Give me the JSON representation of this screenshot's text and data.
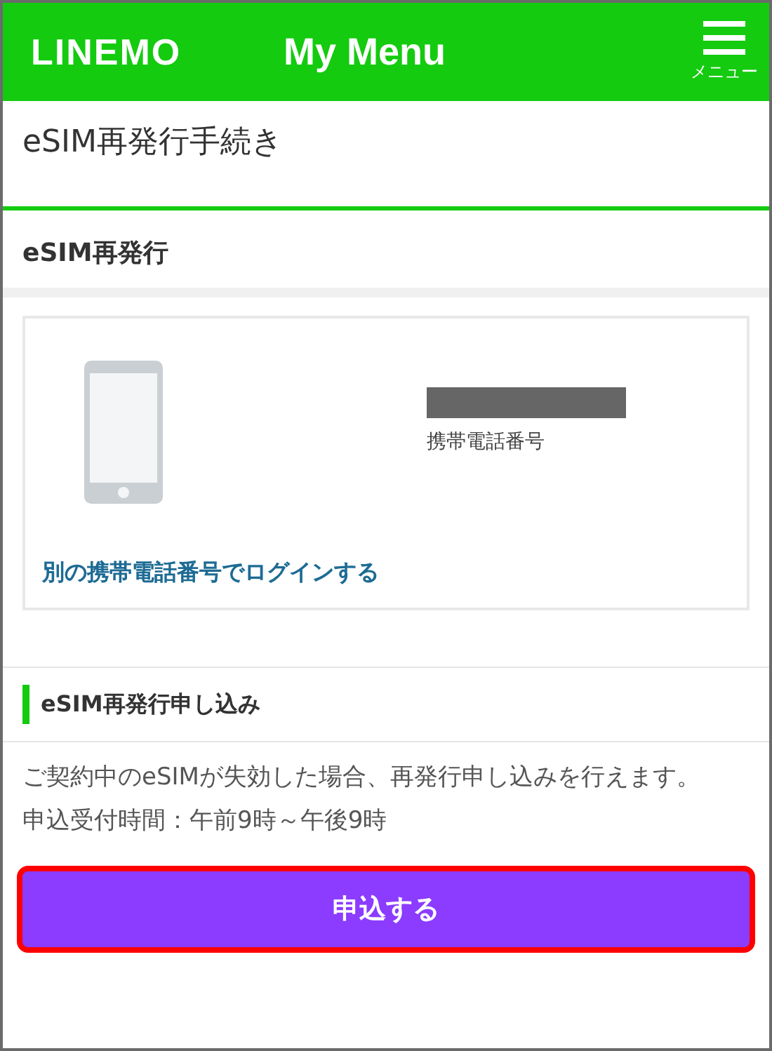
{
  "header": {
    "logo": "LINEMO",
    "title": "My Menu",
    "menu_label": "メニュー"
  },
  "page_title": "eSIM再発行手続き",
  "section_title": "eSIM再発行",
  "account": {
    "phone_label": "携帯電話番号",
    "number_redacted": true,
    "switch_link": "別の携帯電話番号でログインする"
  },
  "apply": {
    "heading": "eSIM再発行申し込み",
    "lines": [
      "ご契約中のeSIMが失効した場合、再発行申し込みを行えます。",
      "申込受付時間：午前9時～午後9時"
    ],
    "button": {
      "label": "申込する",
      "highlighted": true
    }
  }
}
